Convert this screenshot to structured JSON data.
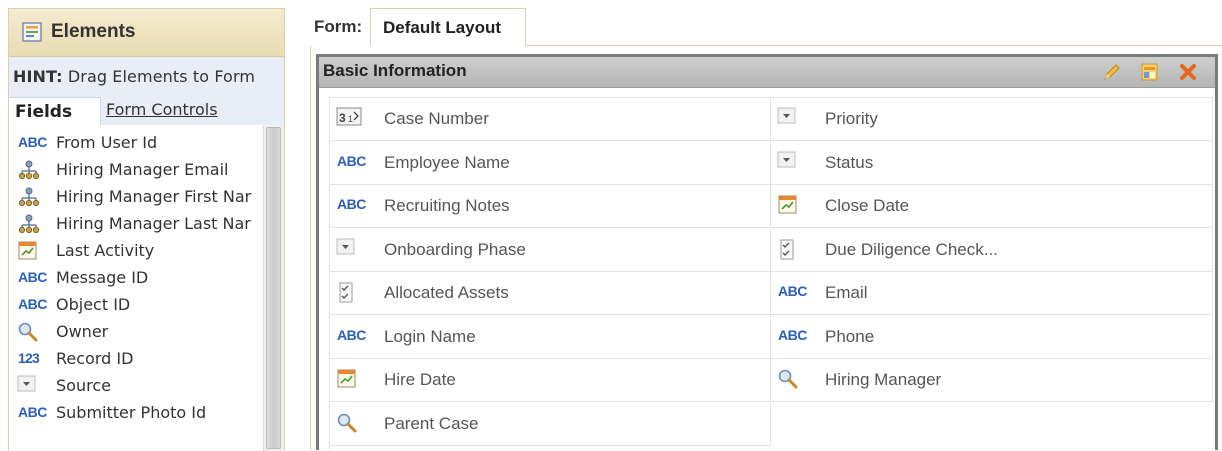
{
  "left_panel": {
    "title": "Elements",
    "hint_prefix": "HINT:",
    "hint_text": "Drag Elements to Form",
    "tabs": {
      "fields": "Fields",
      "form_controls": "Form Controls"
    },
    "fields": [
      {
        "icon": "abc-icon",
        "label": "From User Id"
      },
      {
        "icon": "hierarchy-icon",
        "label": "Hiring Manager Email"
      },
      {
        "icon": "hierarchy-icon",
        "label": "Hiring Manager First Nar"
      },
      {
        "icon": "hierarchy-icon",
        "label": "Hiring Manager Last Nar"
      },
      {
        "icon": "calendar-icon",
        "label": "Last Activity"
      },
      {
        "icon": "abc-icon",
        "label": "Message ID"
      },
      {
        "icon": "abc-icon",
        "label": "Object ID"
      },
      {
        "icon": "lookup-icon",
        "label": "Owner"
      },
      {
        "icon": "number-icon",
        "label": "Record ID"
      },
      {
        "icon": "dropdown-icon",
        "label": "Source"
      },
      {
        "icon": "abc-icon",
        "label": "Submitter Photo Id"
      }
    ]
  },
  "form": {
    "label": "Form:",
    "tab": "Default Layout",
    "section": {
      "title": "Basic Information",
      "actions": [
        "edit-icon",
        "layout-icon",
        "delete-icon"
      ],
      "left_column": [
        {
          "icon": "auto-number-icon",
          "label": "Case Number"
        },
        {
          "icon": "abc-icon",
          "label": "Employee Name"
        },
        {
          "icon": "abc-icon",
          "label": "Recruiting Notes"
        },
        {
          "icon": "dropdown-icon",
          "label": "Onboarding Phase"
        },
        {
          "icon": "checklist-icon",
          "label": "Allocated Assets"
        },
        {
          "icon": "abc-icon",
          "label": "Login Name"
        },
        {
          "icon": "calendar-icon",
          "label": "Hire Date"
        },
        {
          "icon": "lookup-icon",
          "label": "Parent Case"
        }
      ],
      "right_column": [
        {
          "icon": "dropdown-icon",
          "label": "Priority"
        },
        {
          "icon": "dropdown-icon",
          "label": "Status"
        },
        {
          "icon": "calendar-icon",
          "label": "Close Date"
        },
        {
          "icon": "checklist-icon",
          "label": "Due Diligence Check..."
        },
        {
          "icon": "abc-icon",
          "label": "Email"
        },
        {
          "icon": "abc-icon",
          "label": "Phone"
        },
        {
          "icon": "lookup-icon",
          "label": "Hiring Manager"
        }
      ]
    }
  },
  "colors": {
    "abc_blue": "#2b5fb8",
    "header_tan": "#e8dcb2",
    "section_gray": "#bdbdbd",
    "delete_orange": "#e8651b",
    "hint_bg": "#e9eef6"
  }
}
